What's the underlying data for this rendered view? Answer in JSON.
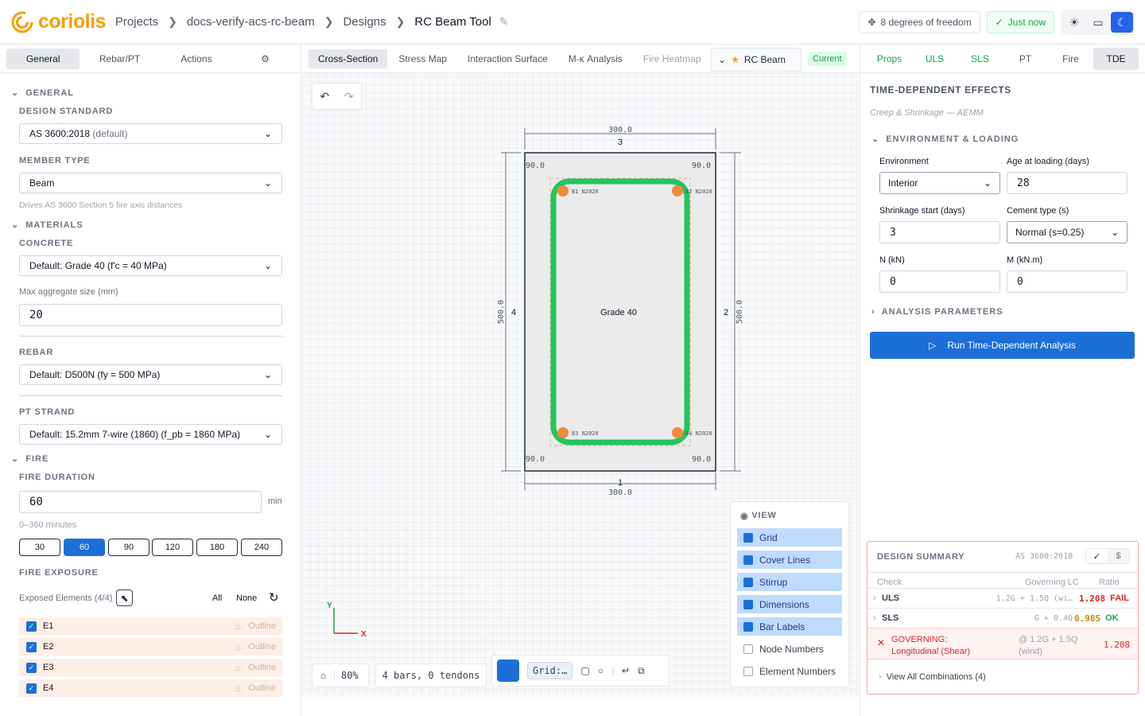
{
  "header": {
    "logo_text": "coriolis",
    "breadcrumbs": [
      "Projects",
      "docs-verify-acs-rc-beam",
      "Designs",
      "RC Beam Tool"
    ],
    "dof_label": "8 degrees of freedom",
    "saved_label": "Just now",
    "theme_options": [
      "sun-icon",
      "monitor-icon",
      "moon-icon"
    ],
    "active_theme": "moon-icon"
  },
  "left": {
    "tabs": [
      "General",
      "Rebar/PT",
      "Actions"
    ],
    "active_tab": "General",
    "general_heading": "GENERAL",
    "design_standard_label": "DESIGN STANDARD",
    "design_standard_value": "AS 3600:2018",
    "design_standard_suffix": "(default)",
    "member_type_label": "MEMBER TYPE",
    "member_type_value": "Beam",
    "member_hint": "Drives AS 3600 Section 5 fire axis distances",
    "materials_heading": "MATERIALS",
    "concrete_label": "CONCRETE",
    "concrete_value": "Default: Grade 40 (f'c = 40 MPa)",
    "agg_label": "Max aggregate size (mm)",
    "agg_value": "20",
    "rebar_label": "REBAR",
    "rebar_value": "Default: D500N (fy = 500 MPa)",
    "pt_label": "PT STRAND",
    "pt_value": "Default: 15.2mm 7-wire (1860) (f_pb = 1860 MPa)",
    "fire_heading": "FIRE",
    "fire_duration_label": "FIRE DURATION",
    "fire_duration_value": "60",
    "fire_unit": "min",
    "fire_range": "0–360 minutes",
    "fire_presets": [
      "30",
      "60",
      "90",
      "120",
      "180",
      "240"
    ],
    "fire_active": "60",
    "exposure_label": "FIRE EXPOSURE",
    "exposed_label": "Exposed Elements (4/4)",
    "all_label": "All",
    "none_label": "None",
    "elements": [
      {
        "name": "E1",
        "mode": "Outline"
      },
      {
        "name": "E2",
        "mode": "Outline"
      },
      {
        "name": "E3",
        "mode": "Outline"
      },
      {
        "name": "E4",
        "mode": "Outline"
      }
    ]
  },
  "center": {
    "tabs": [
      "Cross-Section",
      "Stress Map",
      "Interaction Surface",
      "M-κ Analysis",
      "Fire Heatmap"
    ],
    "active_tab": "Cross-Section",
    "beam_name": "RC Beam",
    "badge": "Current",
    "section": {
      "width_label": "300.0",
      "height_label": "500.0",
      "material_label": "Grade 40",
      "corner_dims": [
        "90.0",
        "90.0",
        "90.0",
        "90.0"
      ],
      "edge_numbers": [
        "3",
        "2",
        "1",
        "4"
      ],
      "bars": [
        {
          "id": "B1",
          "size": "N2020"
        },
        {
          "id": "B2",
          "size": "N2020"
        },
        {
          "id": "B3",
          "size": "N2020"
        },
        {
          "id": "B4",
          "size": "N2020"
        }
      ]
    },
    "axis_x": "X",
    "axis_y": "Y",
    "view": {
      "title": "VIEW",
      "items": [
        {
          "label": "Grid",
          "on": true
        },
        {
          "label": "Cover Lines",
          "on": true
        },
        {
          "label": "Stirrup",
          "on": true
        },
        {
          "label": "Dimensions",
          "on": true
        },
        {
          "label": "Bar Labels",
          "on": true
        },
        {
          "label": "Node Numbers",
          "on": false
        },
        {
          "label": "Element Numbers",
          "on": false
        }
      ]
    },
    "zoom": "80%",
    "count_label": "4 bars, 0 tendons",
    "grid_select": "Grid:…"
  },
  "right": {
    "tabs": [
      "Props",
      "ULS",
      "SLS",
      "PT",
      "Fire",
      "TDE"
    ],
    "active_tab": "TDE",
    "title": "TIME-DEPENDENT EFFECTS",
    "subtitle": "Creep & Shrinkage — AEMM",
    "env_heading": "ENVIRONMENT & LOADING",
    "environment_label": "Environment",
    "environment_value": "Interior",
    "age_label": "Age at loading (days)",
    "age_value": "28",
    "shrink_label": "Shrinkage start (days)",
    "shrink_value": "3",
    "cement_label": "Cement type (s)",
    "cement_value": "Normal (s=0.25)",
    "n_label": "N (kN)",
    "n_value": "0",
    "m_label": "M (kN.m)",
    "m_value": "0",
    "params_heading": "ANALYSIS PARAMETERS",
    "run_label": "Run Time-Dependent Analysis",
    "summary": {
      "title": "DESIGN SUMMARY",
      "standard": "AS 3600:2018",
      "currency": "$",
      "col_check": "Check",
      "col_lc": "Governing LC",
      "col_ratio": "Ratio",
      "rows": [
        {
          "check": "ULS",
          "lc": "1.2G + 1.5Q (wi…",
          "ratio": "1.208",
          "status": "FAIL"
        },
        {
          "check": "SLS",
          "lc": "G + 0.4Q",
          "ratio": "0.985",
          "status": "OK"
        }
      ],
      "governing_label": "GOVERNING: Longitudinal (Shear)",
      "governing_lc": "@ 1.2G + 1.5Q (wind)",
      "governing_ratio": "1.208",
      "view_all": "View All Combinations (4)"
    }
  },
  "colors": {
    "accent": "#1d6fd8",
    "brand": "#f59e0b",
    "stirrup": "#22c55e",
    "bar": "#f58a3c",
    "fail": "#dc2626",
    "ok": "#16a34a"
  }
}
